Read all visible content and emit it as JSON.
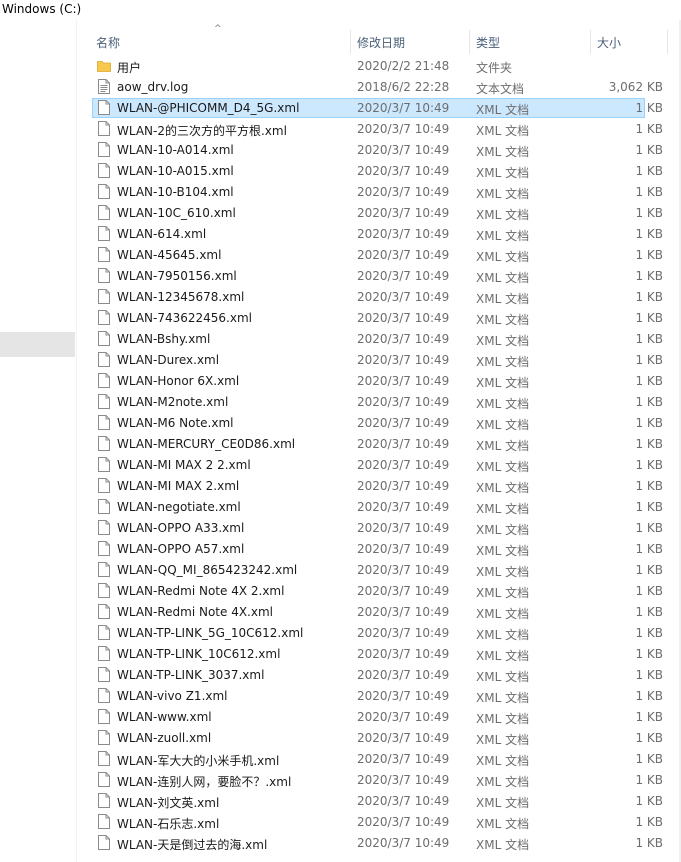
{
  "window": {
    "location": "Windows (C:)"
  },
  "columns": {
    "name": "名称",
    "date": "修改日期",
    "type": "类型",
    "size": "大小"
  },
  "colors": {
    "selected_bg": "#cce8ff",
    "selected_border": "#99d1ff",
    "folder": "#f8c94e",
    "header_text": "#4c607a"
  },
  "files": [
    {
      "name": "用户",
      "date": "2020/2/2 21:48",
      "type": "文件夹",
      "size": "",
      "icon": "folder-icon"
    },
    {
      "name": "aow_drv.log",
      "date": "2018/6/2 22:28",
      "type": "文本文档",
      "size": "3,062 KB",
      "icon": "text-file-icon"
    },
    {
      "name": "WLAN-@PHICOMM_D4_5G.xml",
      "date": "2020/3/7 10:49",
      "type": "XML 文档",
      "size": "1 KB",
      "icon": "xml-file-icon",
      "selected": true
    },
    {
      "name": "WLAN-2的三次方的平方根.xml",
      "date": "2020/3/7 10:49",
      "type": "XML 文档",
      "size": "1 KB",
      "icon": "xml-file-icon"
    },
    {
      "name": "WLAN-10-A014.xml",
      "date": "2020/3/7 10:49",
      "type": "XML 文档",
      "size": "1 KB",
      "icon": "xml-file-icon"
    },
    {
      "name": "WLAN-10-A015.xml",
      "date": "2020/3/7 10:49",
      "type": "XML 文档",
      "size": "1 KB",
      "icon": "xml-file-icon"
    },
    {
      "name": "WLAN-10-B104.xml",
      "date": "2020/3/7 10:49",
      "type": "XML 文档",
      "size": "1 KB",
      "icon": "xml-file-icon"
    },
    {
      "name": "WLAN-10C_610.xml",
      "date": "2020/3/7 10:49",
      "type": "XML 文档",
      "size": "1 KB",
      "icon": "xml-file-icon"
    },
    {
      "name": "WLAN-614.xml",
      "date": "2020/3/7 10:49",
      "type": "XML 文档",
      "size": "1 KB",
      "icon": "xml-file-icon"
    },
    {
      "name": "WLAN-45645.xml",
      "date": "2020/3/7 10:49",
      "type": "XML 文档",
      "size": "1 KB",
      "icon": "xml-file-icon"
    },
    {
      "name": "WLAN-7950156.xml",
      "date": "2020/3/7 10:49",
      "type": "XML 文档",
      "size": "1 KB",
      "icon": "xml-file-icon"
    },
    {
      "name": "WLAN-12345678.xml",
      "date": "2020/3/7 10:49",
      "type": "XML 文档",
      "size": "1 KB",
      "icon": "xml-file-icon"
    },
    {
      "name": "WLAN-743622456.xml",
      "date": "2020/3/7 10:49",
      "type": "XML 文档",
      "size": "1 KB",
      "icon": "xml-file-icon"
    },
    {
      "name": "WLAN-Bshy.xml",
      "date": "2020/3/7 10:49",
      "type": "XML 文档",
      "size": "1 KB",
      "icon": "xml-file-icon"
    },
    {
      "name": "WLAN-Durex.xml",
      "date": "2020/3/7 10:49",
      "type": "XML 文档",
      "size": "1 KB",
      "icon": "xml-file-icon"
    },
    {
      "name": "WLAN-Honor 6X.xml",
      "date": "2020/3/7 10:49",
      "type": "XML 文档",
      "size": "1 KB",
      "icon": "xml-file-icon"
    },
    {
      "name": "WLAN-M2note.xml",
      "date": "2020/3/7 10:49",
      "type": "XML 文档",
      "size": "1 KB",
      "icon": "xml-file-icon"
    },
    {
      "name": "WLAN-M6 Note.xml",
      "date": "2020/3/7 10:49",
      "type": "XML 文档",
      "size": "1 KB",
      "icon": "xml-file-icon"
    },
    {
      "name": "WLAN-MERCURY_CE0D86.xml",
      "date": "2020/3/7 10:49",
      "type": "XML 文档",
      "size": "1 KB",
      "icon": "xml-file-icon"
    },
    {
      "name": "WLAN-MI MAX 2 2.xml",
      "date": "2020/3/7 10:49",
      "type": "XML 文档",
      "size": "1 KB",
      "icon": "xml-file-icon"
    },
    {
      "name": "WLAN-MI MAX 2.xml",
      "date": "2020/3/7 10:49",
      "type": "XML 文档",
      "size": "1 KB",
      "icon": "xml-file-icon"
    },
    {
      "name": "WLAN-negotiate.xml",
      "date": "2020/3/7 10:49",
      "type": "XML 文档",
      "size": "1 KB",
      "icon": "xml-file-icon"
    },
    {
      "name": "WLAN-OPPO A33.xml",
      "date": "2020/3/7 10:49",
      "type": "XML 文档",
      "size": "1 KB",
      "icon": "xml-file-icon"
    },
    {
      "name": "WLAN-OPPO A57.xml",
      "date": "2020/3/7 10:49",
      "type": "XML 文档",
      "size": "1 KB",
      "icon": "xml-file-icon"
    },
    {
      "name": "WLAN-QQ_MI_865423242.xml",
      "date": "2020/3/7 10:49",
      "type": "XML 文档",
      "size": "1 KB",
      "icon": "xml-file-icon"
    },
    {
      "name": "WLAN-Redmi Note 4X 2.xml",
      "date": "2020/3/7 10:49",
      "type": "XML 文档",
      "size": "1 KB",
      "icon": "xml-file-icon"
    },
    {
      "name": "WLAN-Redmi Note 4X.xml",
      "date": "2020/3/7 10:49",
      "type": "XML 文档",
      "size": "1 KB",
      "icon": "xml-file-icon"
    },
    {
      "name": "WLAN-TP-LINK_5G_10C612.xml",
      "date": "2020/3/7 10:49",
      "type": "XML 文档",
      "size": "1 KB",
      "icon": "xml-file-icon"
    },
    {
      "name": "WLAN-TP-LINK_10C612.xml",
      "date": "2020/3/7 10:49",
      "type": "XML 文档",
      "size": "1 KB",
      "icon": "xml-file-icon"
    },
    {
      "name": "WLAN-TP-LINK_3037.xml",
      "date": "2020/3/7 10:49",
      "type": "XML 文档",
      "size": "1 KB",
      "icon": "xml-file-icon"
    },
    {
      "name": "WLAN-vivo Z1.xml",
      "date": "2020/3/7 10:49",
      "type": "XML 文档",
      "size": "1 KB",
      "icon": "xml-file-icon"
    },
    {
      "name": "WLAN-www.xml",
      "date": "2020/3/7 10:49",
      "type": "XML 文档",
      "size": "1 KB",
      "icon": "xml-file-icon"
    },
    {
      "name": "WLAN-zuoll.xml",
      "date": "2020/3/7 10:49",
      "type": "XML 文档",
      "size": "1 KB",
      "icon": "xml-file-icon"
    },
    {
      "name": "WLAN-军大大的小米手机.xml",
      "date": "2020/3/7 10:49",
      "type": "XML 文档",
      "size": "1 KB",
      "icon": "xml-file-icon"
    },
    {
      "name": "WLAN-连别人网，要脸不？.xml",
      "date": "2020/3/7 10:49",
      "type": "XML 文档",
      "size": "1 KB",
      "icon": "xml-file-icon"
    },
    {
      "name": "WLAN-刘文英.xml",
      "date": "2020/3/7 10:49",
      "type": "XML 文档",
      "size": "1 KB",
      "icon": "xml-file-icon"
    },
    {
      "name": "WLAN-石乐志.xml",
      "date": "2020/3/7 10:49",
      "type": "XML 文档",
      "size": "1 KB",
      "icon": "xml-file-icon"
    },
    {
      "name": "WLAN-天是倒过去的海.xml",
      "date": "2020/3/7 10:49",
      "type": "XML 文档",
      "size": "1 KB",
      "icon": "xml-file-icon"
    }
  ]
}
